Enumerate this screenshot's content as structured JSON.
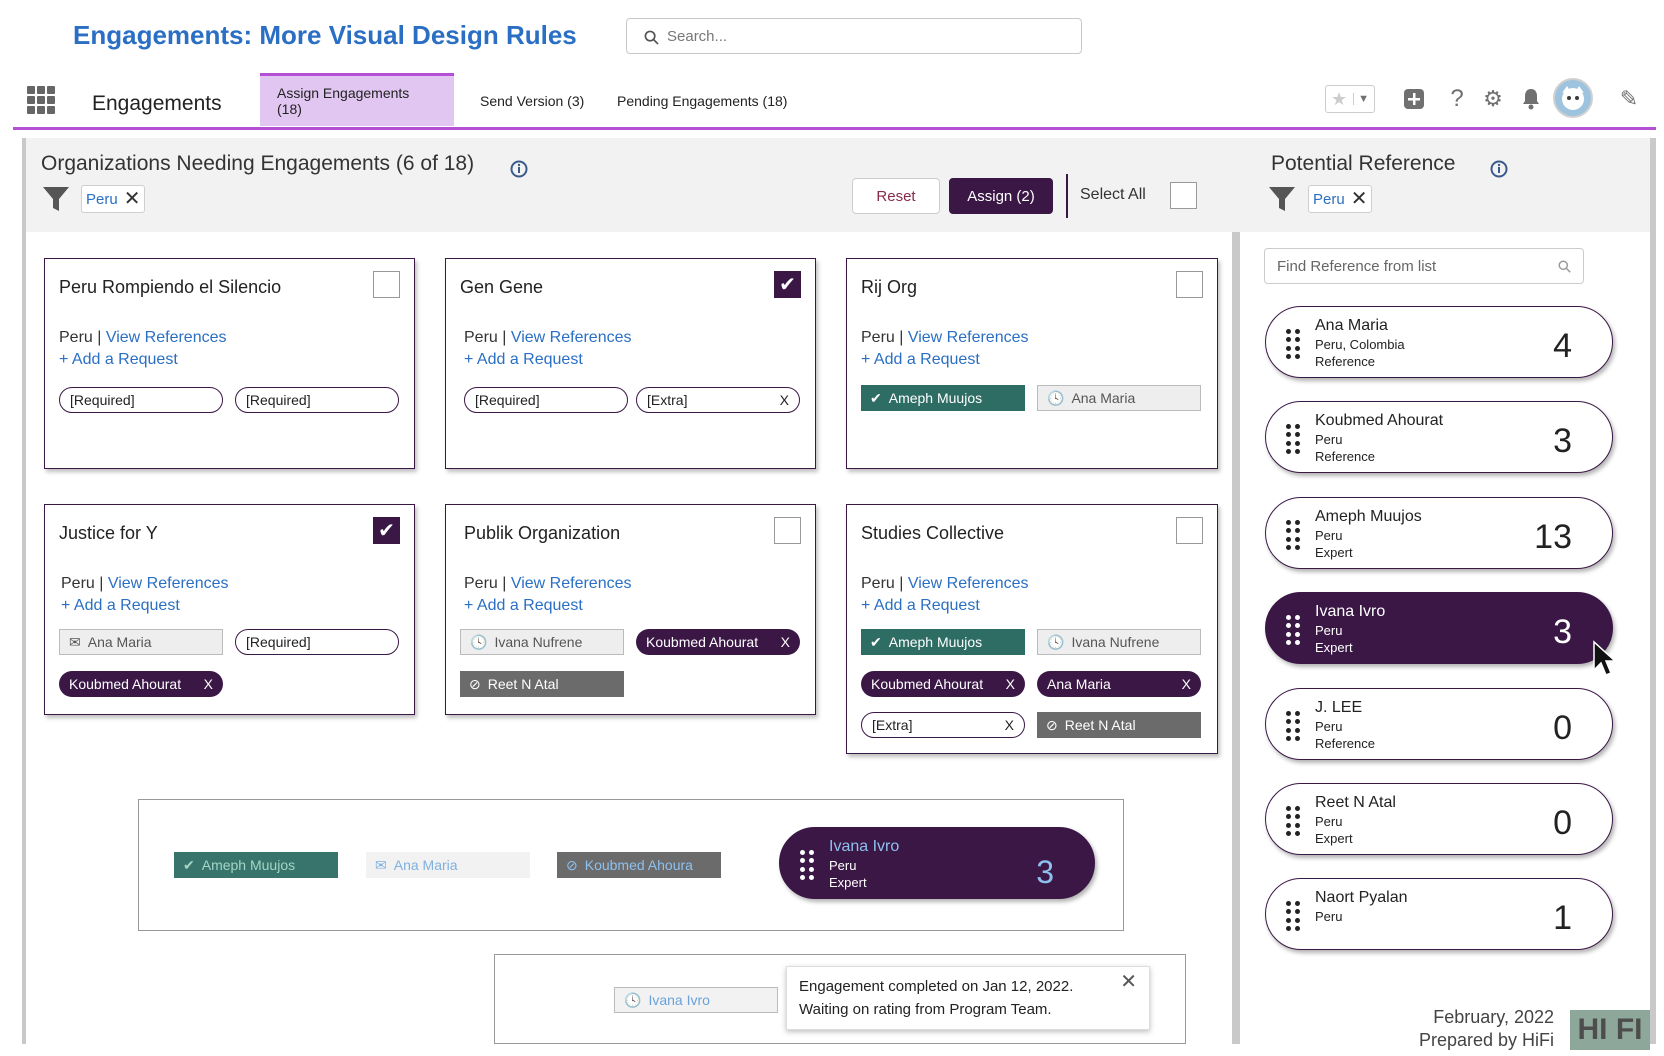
{
  "page_title": "Engagements: More Visual Design Rules",
  "search": {
    "placeholder": "Search..."
  },
  "nav": {
    "app_name": "Engagements",
    "tabs": [
      {
        "label": "Assign Engagements (18)"
      },
      {
        "label": "Send Version (3)"
      },
      {
        "label": "Pending Engagements (18)"
      }
    ]
  },
  "left": {
    "heading": "Organizations Needing Engagements (6 of 18)",
    "filter": "Peru",
    "reset": "Reset",
    "assign": "Assign (2)",
    "select_all": "Select All"
  },
  "cards": [
    {
      "name": "Peru Rompiendo el Silencio",
      "loc": "Peru",
      "view": "View References",
      "add": "+ Add a Request",
      "checked": false
    },
    {
      "name": "Gen Gene",
      "loc": "Peru",
      "view": "View References",
      "add": "+ Add a Request",
      "checked": true
    },
    {
      "name": "Rij Org",
      "loc": "Peru",
      "view": "View References",
      "add": "+ Add a Request",
      "checked": false
    },
    {
      "name": "Justice for Y",
      "loc": "Peru",
      "view": "View References",
      "add": "+ Add a Request",
      "checked": true
    },
    {
      "name": "Publik Organization",
      "loc": "Peru",
      "view": "View References",
      "add": "+ Add a Request",
      "checked": false
    },
    {
      "name": "Studies Collective",
      "loc": "Peru",
      "view": "View References",
      "add": "+ Add a Request",
      "checked": false
    }
  ],
  "chips": {
    "required": "[Required]",
    "extra": "[Extra]",
    "x": "X",
    "ameph": "Ameph Muujos",
    "ana": "Ana Maria",
    "koubmed": "Koubmed Ahourat",
    "ivana": "Ivana Nufrene",
    "reet": "Reet N Atal"
  },
  "right": {
    "heading": "Potential Reference",
    "filter": "Peru",
    "find_placeholder": "Find Reference from list",
    "refs": [
      {
        "name": "Ana Maria",
        "line1": "Peru, Colombia",
        "line2": "Reference",
        "count": "4"
      },
      {
        "name": "Koubmed Ahourat",
        "line1": "Peru",
        "line2": "Reference",
        "count": "3"
      },
      {
        "name": "Ameph Muujos",
        "line1": "Peru",
        "line2": "Expert",
        "count": "13"
      },
      {
        "name": "Ivana Ivro",
        "line1": "Peru",
        "line2": "Expert",
        "count": "3"
      },
      {
        "name": "J. LEE",
        "line1": "Peru",
        "line2": "Reference",
        "count": "0"
      },
      {
        "name": "Reet N Atal",
        "line1": "Peru",
        "line2": "Expert",
        "count": "0"
      },
      {
        "name": "Naort Pyalan",
        "line1": "Peru",
        "line2": "",
        "count": "1"
      }
    ]
  },
  "legend": {
    "ameph": "Ameph Muujos",
    "ana": "Ana Maria",
    "koubmed": "Koubmed Ahoura",
    "ref": {
      "name": "Ivana Ivro",
      "line1": "Peru",
      "line2": "Expert",
      "count": "3"
    },
    "ivana": "Ivana Ivro",
    "tooltip_line1": "Engagement completed on Jan 12, 2022.",
    "tooltip_line2": "Waiting on rating from Program Team."
  },
  "footer": {
    "date": "February, 2022",
    "by": "Prepared by HiFi",
    "logo": "HI FI"
  },
  "colors": {
    "accent": "#2a6fc4",
    "primary": "#3b1746",
    "tab_active": "#e1c6f2",
    "green": "#2e6d64"
  }
}
